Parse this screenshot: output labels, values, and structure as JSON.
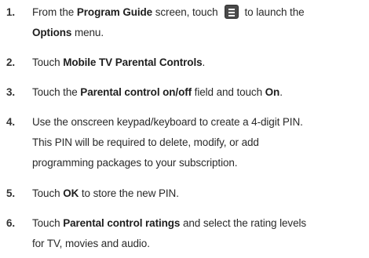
{
  "steps": [
    {
      "number": "1.",
      "line1_a": "From the ",
      "line1_b": "Program Guide",
      "line1_c": " screen, touch",
      "line1_d": "to launch the",
      "line2_a": "Options",
      "line2_b": " menu.",
      "icon": "menu-icon"
    },
    {
      "number": "2.",
      "a": "Touch ",
      "b": "Mobile TV Parental Controls",
      "c": "."
    },
    {
      "number": "3.",
      "a": "Touch the ",
      "b": "Parental control on/off",
      "c": " field and touch ",
      "d": "On",
      "e": "."
    },
    {
      "number": "4.",
      "line1": "Use the onscreen keypad/keyboard to create a 4-digit PIN.",
      "line2": "This PIN will be required to delete, modify, or add",
      "line3": "programming packages to your subscription."
    },
    {
      "number": "5.",
      "a": "Touch ",
      "b": "OK",
      "c": " to store the new PIN."
    },
    {
      "number": "6.",
      "line1_a": "Touch ",
      "line1_b": "Parental control ratings",
      "line1_c": " and select the rating levels",
      "line2": "for TV, movies and audio."
    }
  ]
}
